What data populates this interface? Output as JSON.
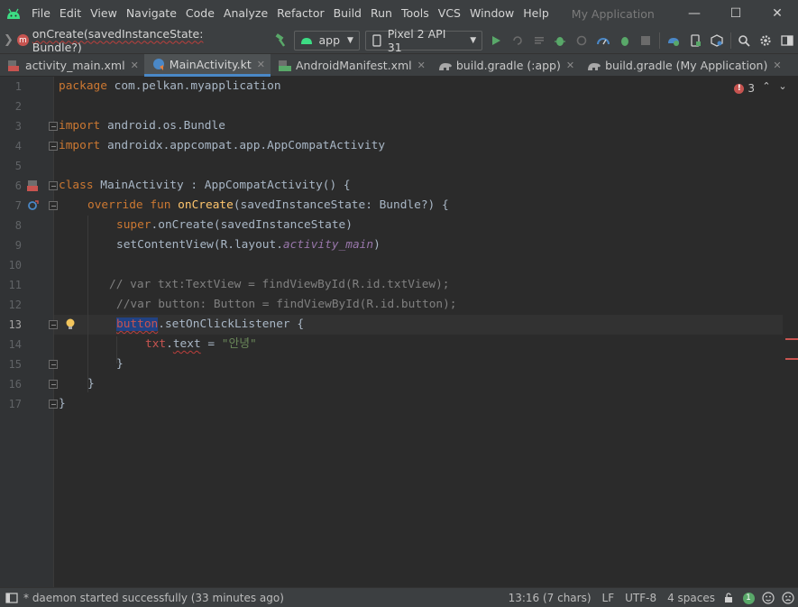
{
  "window": {
    "title": "My Application",
    "menu": [
      "File",
      "Edit",
      "View",
      "Navigate",
      "Code",
      "Analyze",
      "Refactor",
      "Build",
      "Run",
      "Tools",
      "VCS",
      "Window",
      "Help"
    ],
    "controls": {
      "minimize": "—",
      "maximize": "☐",
      "close": "✕"
    }
  },
  "toolbar": {
    "breadcrumb_badge": "m",
    "breadcrumb": "onCreate(savedInstanceState: Bundle?)",
    "run_config": "app",
    "device": "Pixel 2 API 31"
  },
  "tabs": [
    {
      "label": "activity_main.xml",
      "icon": "xml-layout-icon",
      "active": false
    },
    {
      "label": "MainActivity.kt",
      "icon": "kotlin-class-icon",
      "active": true
    },
    {
      "label": "AndroidManifest.xml",
      "icon": "manifest-icon",
      "active": false
    },
    {
      "label": "build.gradle (:app)",
      "icon": "gradle-icon",
      "active": false
    },
    {
      "label": "build.gradle (My Application)",
      "icon": "gradle-icon",
      "active": false
    }
  ],
  "editor": {
    "error_count": "3",
    "line_numbers": [
      "1",
      "2",
      "3",
      "4",
      "5",
      "6",
      "7",
      "8",
      "9",
      "10",
      "11",
      "12",
      "13",
      "14",
      "15",
      "16",
      "17"
    ],
    "current_line": "13",
    "code": {
      "l1_kw": "package",
      "l1_pkg": " com.pelkan.myapplication",
      "l3_kw": "import",
      "l3_rest": " android.os.Bundle",
      "l4_kw": "import",
      "l4_rest": " androidx.appcompat.app.AppCompatActivity",
      "l6_kw": "class",
      "l6_rest": " MainActivity : AppCompatActivity() {",
      "l7_kw": "override fun",
      "l7_fn": "onCreate",
      "l7_rest": "(savedInstanceState: Bundle?) {",
      "l8_kw": "super",
      "l8_rest": ".onCreate(savedInstanceState)",
      "l9_a": "setContentView(R.layout.",
      "l9_prop": "activity_main",
      "l9_b": ")",
      "l11": "// var txt:TextView = findViewById(R.id.txtView);",
      "l12": "//var button: Button = findViewById(R.id.button);",
      "l13_sel": "button",
      "l13_rest": ".setOnClickListener {",
      "l14_a": "txt",
      "l14_b": ".",
      "l14_c": "text",
      "l14_d": " = ",
      "l14_str": "\"안녕\"",
      "l15": "}",
      "l16": "}",
      "l17": "}"
    }
  },
  "statusbar": {
    "message": "* daemon started successfully (33 minutes ago)",
    "position": "13:16 (7 chars)",
    "line_sep": "LF",
    "encoding": "UTF-8",
    "indent": "4 spaces",
    "notification_count": "1"
  }
}
